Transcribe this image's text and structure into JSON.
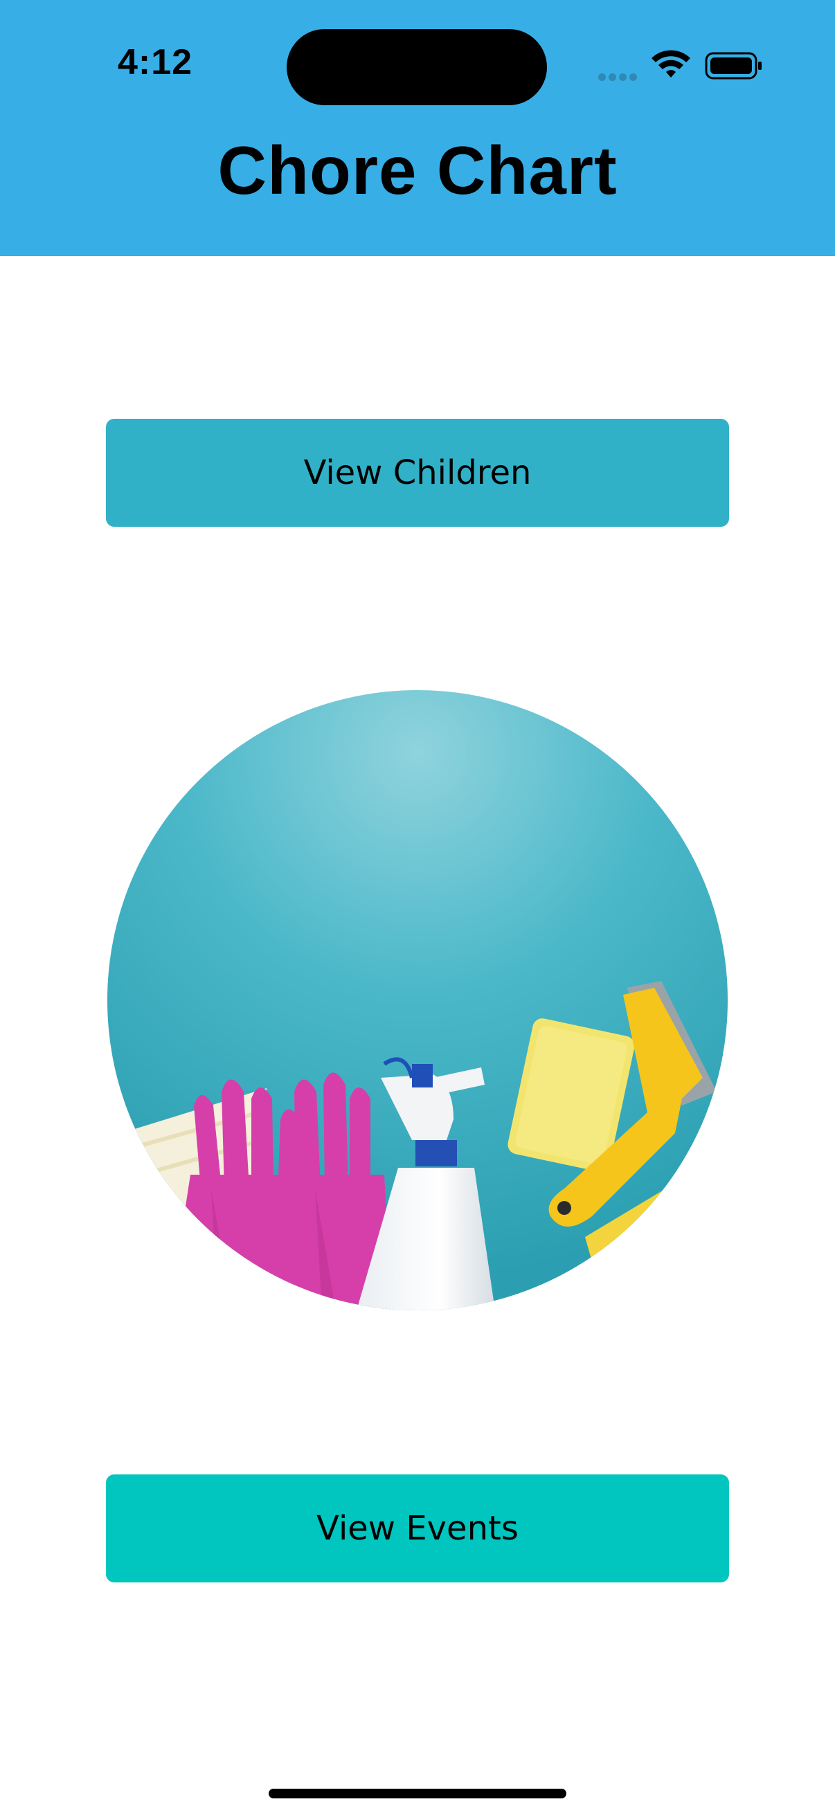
{
  "status_bar": {
    "time": "4:12",
    "icons": [
      "signal-dots-icon",
      "wifi-icon",
      "battery-icon"
    ]
  },
  "header": {
    "title": "Chore Chart",
    "background_color": "#37aee6"
  },
  "buttons": {
    "view_children_label": "View Children",
    "view_events_label": "View Events"
  },
  "hero_image": {
    "icon": "cleaning-supplies-image"
  },
  "colors": {
    "children_button": "#31b1c7",
    "events_button": "#00c6bf"
  }
}
